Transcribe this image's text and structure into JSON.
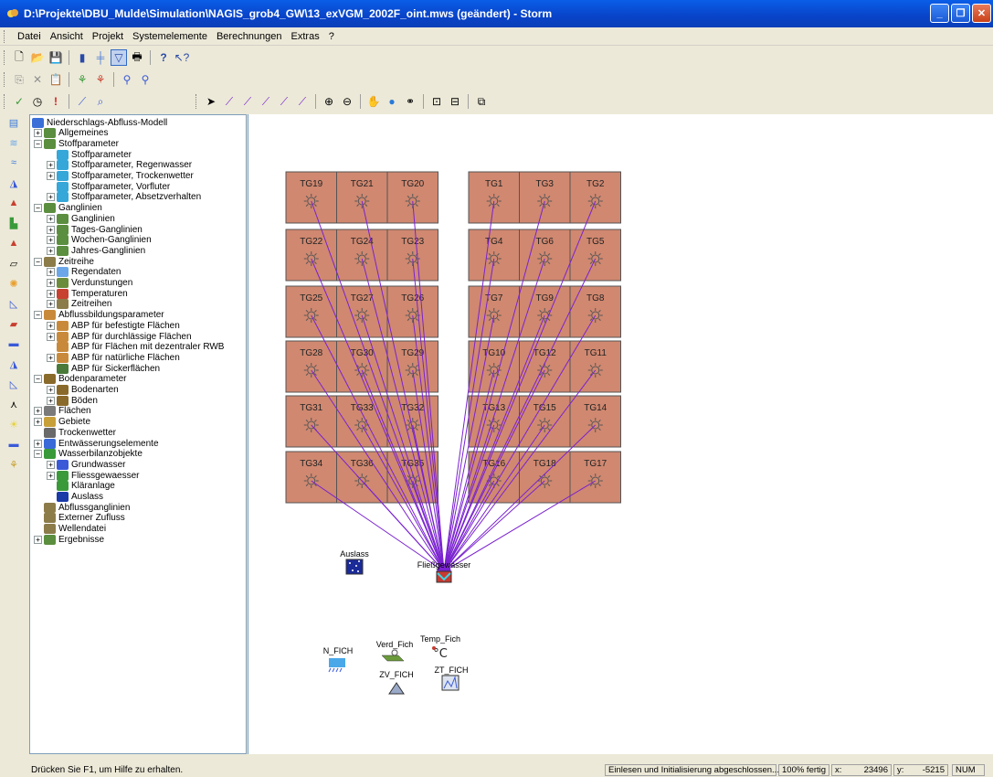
{
  "window": {
    "title": "D:\\Projekte\\DBU_Mulde\\Simulation\\NAGIS_grob4_GW\\13_exVGM_2002F_oint.mws (geändert) - Storm"
  },
  "menu": {
    "items": [
      "Datei",
      "Ansicht",
      "Projekt",
      "Systemelemente",
      "Berechnungen",
      "Extras",
      "?"
    ]
  },
  "tree": {
    "items": [
      {
        "label": "Niederschlags-Abfluss-Modell",
        "level": 0,
        "exp": "",
        "color": "#3a6fd8"
      },
      {
        "label": "Allgemeines",
        "level": 1,
        "exp": "+",
        "color": "#5b8e3e"
      },
      {
        "label": "Stoffparameter",
        "level": 1,
        "exp": "-",
        "color": "#5b8e3e"
      },
      {
        "label": "Stoffparameter",
        "level": 2,
        "exp": "",
        "color": "#35a7d8"
      },
      {
        "label": "Stoffparameter, Regenwasser",
        "level": 2,
        "exp": "+",
        "color": "#35a7d8"
      },
      {
        "label": "Stoffparameter, Trockenwetter",
        "level": 2,
        "exp": "+",
        "color": "#35a7d8"
      },
      {
        "label": "Stoffparameter, Vorfluter",
        "level": 2,
        "exp": "",
        "color": "#35a7d8"
      },
      {
        "label": "Stoffparameter, Absetzverhalten",
        "level": 2,
        "exp": "+",
        "color": "#35a7d8"
      },
      {
        "label": "Ganglinien",
        "level": 1,
        "exp": "-",
        "color": "#5b8e3e"
      },
      {
        "label": "Ganglinien",
        "level": 2,
        "exp": "+",
        "color": "#5b8e3e"
      },
      {
        "label": "Tages-Ganglinien",
        "level": 2,
        "exp": "+",
        "color": "#5b8e3e"
      },
      {
        "label": "Wochen-Ganglinien",
        "level": 2,
        "exp": "+",
        "color": "#5b8e3e"
      },
      {
        "label": "Jahres-Ganglinien",
        "level": 2,
        "exp": "+",
        "color": "#5b8e3e"
      },
      {
        "label": "Zeitreihe",
        "level": 1,
        "exp": "-",
        "color": "#8c7c4a"
      },
      {
        "label": "Regendaten",
        "level": 2,
        "exp": "+",
        "color": "#6aa6e8"
      },
      {
        "label": "Verdunstungen",
        "level": 2,
        "exp": "+",
        "color": "#6b8c3a"
      },
      {
        "label": "Temperaturen",
        "level": 2,
        "exp": "+",
        "color": "#c84030"
      },
      {
        "label": "Zeitreihen",
        "level": 2,
        "exp": "+",
        "color": "#8c7c4a"
      },
      {
        "label": "Abflussbildungsparameter",
        "level": 1,
        "exp": "-",
        "color": "#c88a3a"
      },
      {
        "label": "ABP für befestigte Flächen",
        "level": 2,
        "exp": "+",
        "color": "#c88a3a"
      },
      {
        "label": "ABP für durchlässige Flächen",
        "level": 2,
        "exp": "+",
        "color": "#c88a3a"
      },
      {
        "label": "ABP für Flächen mit dezentraler RWB",
        "level": 2,
        "exp": "",
        "color": "#c88a3a"
      },
      {
        "label": "ABP für natürliche Flächen",
        "level": 2,
        "exp": "+",
        "color": "#c88a3a"
      },
      {
        "label": "ABP für Sickerflächen",
        "level": 2,
        "exp": "",
        "color": "#4a7a3a"
      },
      {
        "label": "Bodenparameter",
        "level": 1,
        "exp": "-",
        "color": "#8a6a2a"
      },
      {
        "label": "Bodenarten",
        "level": 2,
        "exp": "+",
        "color": "#8a6a2a"
      },
      {
        "label": "Böden",
        "level": 2,
        "exp": "+",
        "color": "#8a6a2a"
      },
      {
        "label": "Flächen",
        "level": 1,
        "exp": "+",
        "color": "#7a7a7a"
      },
      {
        "label": "Gebiete",
        "level": 1,
        "exp": "+",
        "color": "#c8a03a"
      },
      {
        "label": "Trockenwetter",
        "level": 1,
        "exp": "",
        "color": "#6a6a6a"
      },
      {
        "label": "Entwässerungselemente",
        "level": 1,
        "exp": "+",
        "color": "#3a6ad8"
      },
      {
        "label": "Wasserbilanzobjekte",
        "level": 1,
        "exp": "-",
        "color": "#3a9a3a"
      },
      {
        "label": "Grundwasser",
        "level": 2,
        "exp": "+",
        "color": "#3a5ad8"
      },
      {
        "label": "Fliessgewaesser",
        "level": 2,
        "exp": "+",
        "color": "#3a9a3a"
      },
      {
        "label": "Kläranlage",
        "level": 2,
        "exp": "",
        "color": "#3a9a3a"
      },
      {
        "label": "Auslass",
        "level": 2,
        "exp": "",
        "color": "#1a3aa8"
      },
      {
        "label": "Abflussganglinien",
        "level": 1,
        "exp": "",
        "color": "#8c7c4a"
      },
      {
        "label": "Externer Zufluss",
        "level": 1,
        "exp": "",
        "color": "#8c7c4a"
      },
      {
        "label": "Wellendatei",
        "level": 1,
        "exp": "",
        "color": "#8c7c4a"
      },
      {
        "label": "Ergebnisse",
        "level": 1,
        "exp": "+",
        "color": "#5b8e3e"
      }
    ]
  },
  "canvas": {
    "left_blocks": [
      [
        "TG19",
        "TG21",
        "TG20"
      ],
      [
        "TG22",
        "TG24",
        "TG23"
      ],
      [
        "TG25",
        "TG27",
        "TG26"
      ],
      [
        "TG28",
        "TG30",
        "TG29"
      ],
      [
        "TG31",
        "TG33",
        "TG32"
      ],
      [
        "TG34",
        "TG36",
        "TG35"
      ]
    ],
    "right_blocks": [
      [
        "TG1",
        "TG3",
        "TG2"
      ],
      [
        "TG4",
        "TG6",
        "TG5"
      ],
      [
        "TG7",
        "TG9",
        "TG8"
      ],
      [
        "TG10",
        "TG12",
        "TG11"
      ],
      [
        "TG13",
        "TG15",
        "TG14"
      ],
      [
        "TG16",
        "TG18",
        "TG17"
      ]
    ],
    "outlet_label": "Auslass",
    "river_label": "Fließgewässer",
    "n_label": "N_FICH",
    "verd_label": "Verd_Fich",
    "temp_label": "Temp_Fich",
    "zv_label": "ZV_FICH",
    "zt_label": "ZT_FICH",
    "block_color": "#d08870",
    "arrow_color": "#7a22d0"
  },
  "status": {
    "help": "Drücken Sie F1, um Hilfe zu erhalten.",
    "message": "Einlesen und Initialisierung abgeschlossen...",
    "progress": "100% fertig",
    "x_label": "x:",
    "x_value": "23496",
    "y_label": "y:",
    "y_value": "-5215",
    "num": "NUM"
  }
}
